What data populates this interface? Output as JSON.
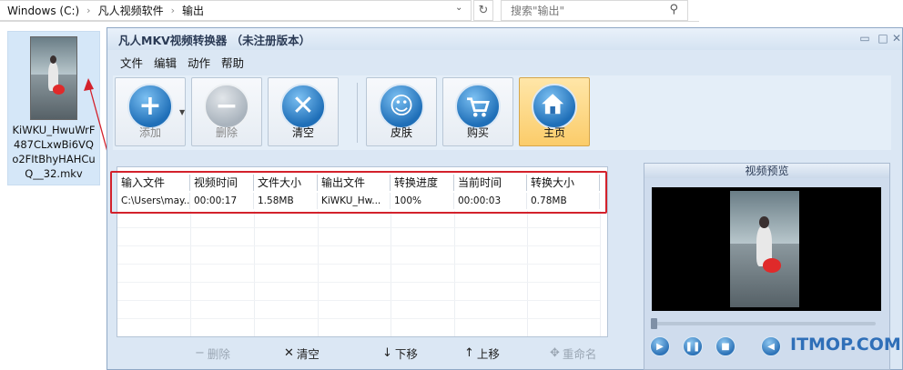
{
  "explorer": {
    "breadcrumbs": [
      "Windows (C:)",
      "凡人视频软件",
      "输出"
    ],
    "search_placeholder": "搜索\"输出\""
  },
  "desktop_file": {
    "name": "KiWKU_HwuWrF487CLxwBi6VQo2FItBhyHAHCuQ__32.mkv"
  },
  "window": {
    "title": "凡人MKV视频转换器 （未注册版本）",
    "menu": [
      "文件",
      "编辑",
      "动作",
      "帮助"
    ],
    "toolbar": {
      "add": "添加",
      "delete": "删除",
      "clear": "清空",
      "skin": "皮肤",
      "buy": "购买",
      "home": "主页"
    },
    "table": {
      "columns": [
        "输入文件",
        "视频时间",
        "文件大小",
        "输出文件",
        "转换进度",
        "当前时间",
        "转换大小"
      ],
      "rows": [
        [
          "C:\\Users\\may...",
          "00:00:17",
          "1.58MB",
          "KiWKU_Hw...",
          "100%",
          "00:00:03",
          "0.78MB"
        ]
      ]
    },
    "bottom_actions": {
      "delete": "删除",
      "clear": "清空",
      "down": "下移",
      "up": "上移",
      "rename": "重命名"
    },
    "preview": {
      "title": "视频预览",
      "playback_position": 0.0
    },
    "watermark": "ITMOP.COM"
  },
  "colors": {
    "highlight_border": "#d3212b",
    "window_bg": "#dbe7f4",
    "home_active": "#fbcc6a"
  },
  "icons": {
    "add": "plus-icon",
    "delete": "minus-icon",
    "clear": "x-icon",
    "skin": "smiley-icon",
    "buy": "cart-icon",
    "home": "house-icon"
  }
}
